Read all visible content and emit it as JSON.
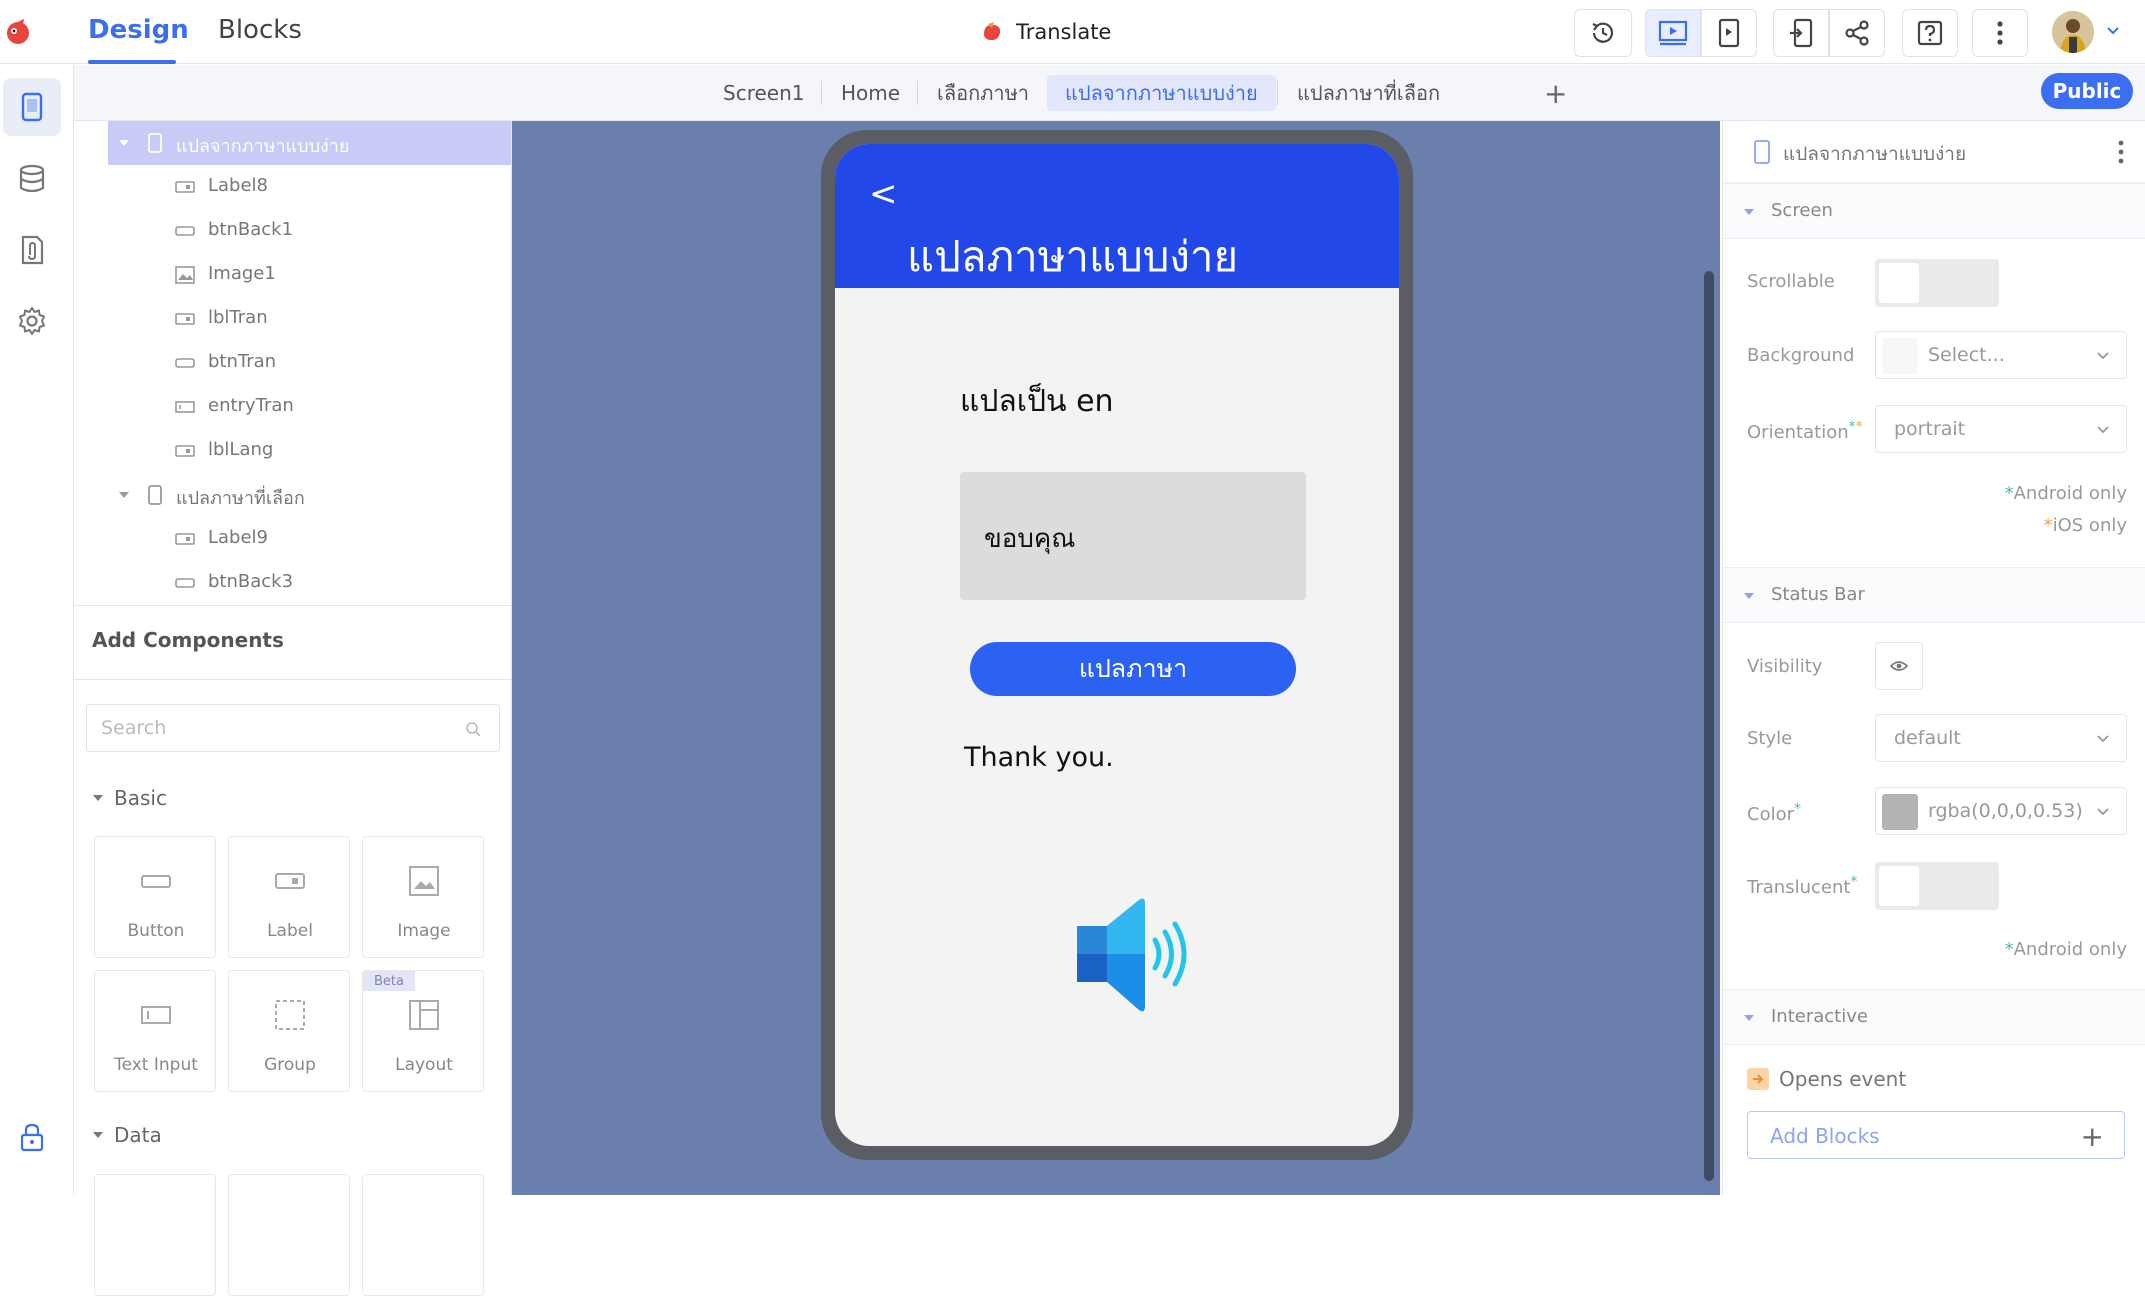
{
  "header": {
    "mode_tabs": [
      "Design",
      "Blocks"
    ],
    "active_mode": "Design",
    "app_title": "Translate",
    "icons": [
      "history-icon",
      "preview-icon",
      "phone-preview-icon",
      "export-icon",
      "share-icon",
      "help-icon",
      "more-icon"
    ]
  },
  "screen_tabs": {
    "tabs": [
      "Screen1",
      "Home",
      "เลือกภาษา",
      "แปลจากภาษาแบบง่าย",
      "แปลภาษาที่เลือก"
    ],
    "active": "แปลจากภาษาแบบง่าย",
    "add_label": "+",
    "public_label": "Public"
  },
  "tree": {
    "items": [
      {
        "label": "แปลจากภาษาแบบง่าย",
        "type": "screen",
        "selected": true
      },
      {
        "label": "Label8",
        "type": "label"
      },
      {
        "label": "btnBack1",
        "type": "button"
      },
      {
        "label": "Image1",
        "type": "image"
      },
      {
        "label": "lblTran",
        "type": "label"
      },
      {
        "label": "btnTran",
        "type": "button"
      },
      {
        "label": "entryTran",
        "type": "textinput"
      },
      {
        "label": "lblLang",
        "type": "label"
      },
      {
        "label": "แปลภาษาที่เลือก",
        "type": "screen"
      },
      {
        "label": "Label9",
        "type": "label"
      },
      {
        "label": "btnBack3",
        "type": "button"
      }
    ]
  },
  "add_components": {
    "title": "Add Components",
    "search_placeholder": "Search",
    "sections": {
      "basic": "Basic",
      "data": "Data"
    },
    "basic_items": [
      {
        "label": "Button",
        "icon": "button-icon"
      },
      {
        "label": "Label",
        "icon": "label-icon"
      },
      {
        "label": "Image",
        "icon": "image-icon"
      },
      {
        "label": "Text Input",
        "icon": "text-input-icon"
      },
      {
        "label": "Group",
        "icon": "group-icon"
      },
      {
        "label": "Layout",
        "icon": "layout-icon",
        "badge": "Beta"
      }
    ]
  },
  "phone": {
    "back_symbol": "<",
    "screen_title": "แปลภาษาแบบง่าย",
    "lang_label": "แปลเป็น en",
    "entry_value": "ขอบคุณ",
    "translate_button": "แปลภาษา",
    "result_text": "Thank you.",
    "header_color": "#2348e8",
    "button_color": "#2b62f2"
  },
  "props": {
    "title": "แปลจากภาษาแบบง่าย",
    "sections": {
      "screen": "Screen",
      "status_bar": "Status Bar",
      "interactive": "Interactive"
    },
    "scrollable_label": "Scrollable",
    "background_label": "Background",
    "background_value": "Select...",
    "orientation_label": "Orientation",
    "orientation_value": "portrait",
    "android_only": "Android only",
    "ios_only": "iOS only",
    "visibility_label": "Visibility",
    "style_label": "Style",
    "style_value": "default",
    "color_label": "Color",
    "color_value": "rgba(0,0,0,0.53)",
    "translucent_label": "Translucent",
    "opens_event": "Opens event",
    "add_blocks": "Add Blocks"
  }
}
